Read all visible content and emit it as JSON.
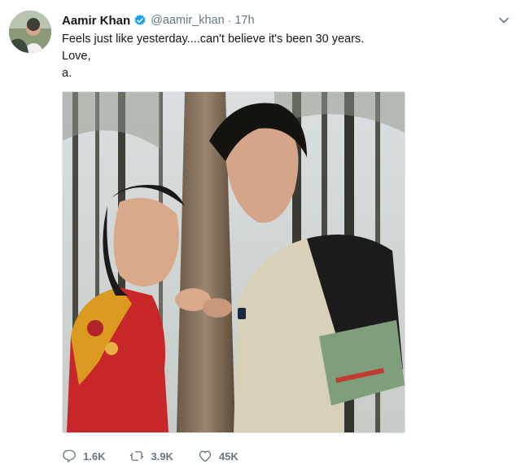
{
  "tweet": {
    "author_name": "Aamir Khan",
    "handle": "@aamir_khan",
    "separator": "·",
    "time": "17h",
    "text_lines": [
      "Feels just like yesterday....can't believe it's been 30 years.",
      "Love,",
      "a."
    ],
    "verified": true,
    "counts": {
      "replies": "1.6K",
      "retweets": "3.9K",
      "likes": "45K"
    }
  },
  "icons": {
    "verified": "verified-badge-icon",
    "menu": "chevron-down-icon",
    "reply": "reply-icon",
    "retweet": "retweet-icon",
    "like": "heart-icon"
  },
  "colors": {
    "verified_blue": "#1da1f2",
    "secondary_text": "#657786",
    "primary_text": "#14171a"
  }
}
